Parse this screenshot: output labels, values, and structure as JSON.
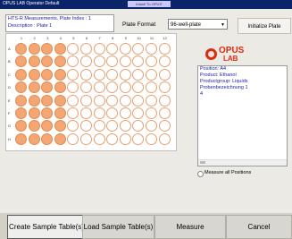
{
  "window": {
    "title": "OPUS LAB Operator Default",
    "center_text": "Install 'To OPUS'"
  },
  "header": {
    "info_line1": "HTS-R Measurements. Plate Index : 1",
    "info_line2": "Description : Plate 1",
    "plate_format_label": "Plate Format",
    "plate_format_value": "96-well-plate",
    "initialize_label": "Initialize Plate"
  },
  "plate": {
    "columns": [
      "1",
      "2",
      "3",
      "4",
      "5",
      "6",
      "7",
      "8",
      "9",
      "10",
      "11",
      "12"
    ],
    "rows": [
      "A",
      "B",
      "C",
      "D",
      "E",
      "F",
      "G",
      "H"
    ],
    "filled_columns_per_row": 4,
    "filled_color": "#f4a774",
    "empty_border_color": "#e6a070"
  },
  "logo": {
    "line1": "OPUS",
    "line2": "LAB",
    "color": "#dd2c10"
  },
  "position_info": {
    "lines": [
      "Position: A4",
      "Product: Ethanol",
      "Productgroup: Liquids",
      "Probenbezeichnung 1",
      "4"
    ]
  },
  "options": {
    "measure_all_label": "Measure all Positions"
  },
  "buttons": {
    "create": "Create Sample Table(s)",
    "load": "Load Sample Table(s)",
    "measure": "Measure",
    "cancel": "Cancel"
  }
}
